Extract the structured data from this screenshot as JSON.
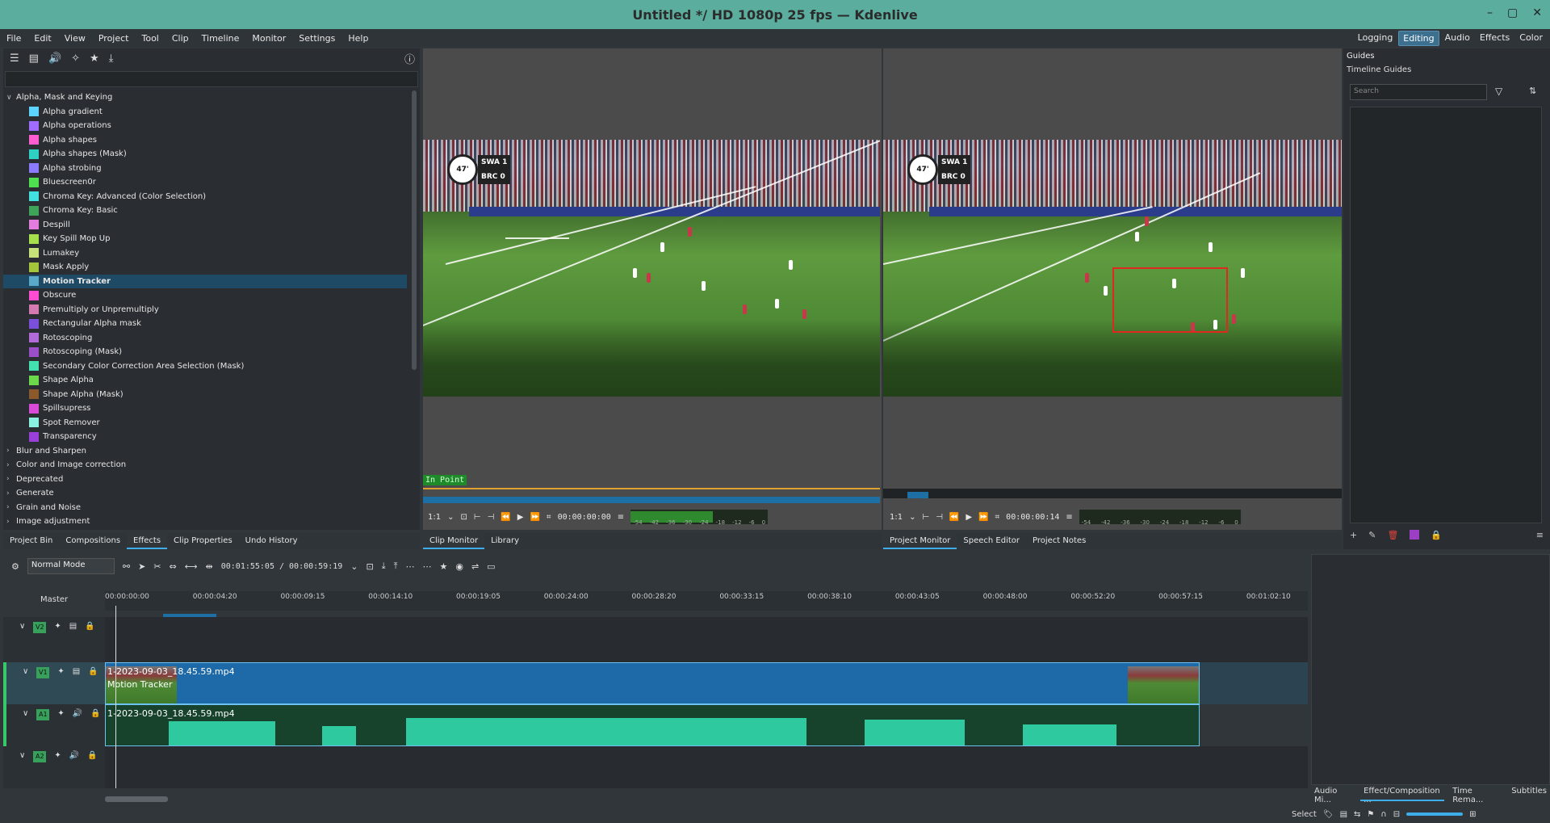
{
  "window": {
    "title": "Untitled */ HD 1080p 25 fps — Kdenlive"
  },
  "menubar": [
    "File",
    "Edit",
    "View",
    "Project",
    "Tool",
    "Clip",
    "Timeline",
    "Monitor",
    "Settings",
    "Help"
  ],
  "layouts": {
    "items": [
      "Logging",
      "Editing",
      "Audio",
      "Effects",
      "Color"
    ],
    "active": "Editing"
  },
  "effects": {
    "tree": [
      {
        "kind": "cat",
        "label": "Alpha, Mask and Keying",
        "open": true
      },
      {
        "kind": "leaf",
        "label": "Alpha gradient",
        "color": "#5dd4ff"
      },
      {
        "kind": "leaf",
        "label": "Alpha operations",
        "color": "#9f6cff"
      },
      {
        "kind": "leaf",
        "label": "Alpha shapes",
        "color": "#ff5ccf"
      },
      {
        "kind": "leaf",
        "label": "Alpha shapes (Mask)",
        "color": "#2ed1c2"
      },
      {
        "kind": "leaf",
        "label": "Alpha strobing",
        "color": "#8a7bff"
      },
      {
        "kind": "leaf",
        "label": "Bluescreen0r",
        "color": "#4fe04f"
      },
      {
        "kind": "leaf",
        "label": "Chroma Key: Advanced (Color Selection)",
        "color": "#43e0e0"
      },
      {
        "kind": "leaf",
        "label": "Chroma Key: Basic",
        "color": "#3fa35a"
      },
      {
        "kind": "leaf",
        "label": "Despill",
        "color": "#e27cdd"
      },
      {
        "kind": "leaf",
        "label": "Key Spill Mop Up",
        "color": "#a6e04a"
      },
      {
        "kind": "leaf",
        "label": "Lumakey",
        "color": "#c6e07a"
      },
      {
        "kind": "leaf",
        "label": "Mask Apply",
        "color": "#a3c63a"
      },
      {
        "kind": "leaf",
        "label": "Motion Tracker",
        "color": "#5aa9c9",
        "selected": true
      },
      {
        "kind": "leaf",
        "label": "Obscure",
        "color": "#ff4cd2"
      },
      {
        "kind": "leaf",
        "label": "Premultiply or Unpremultiply",
        "color": "#d37ab0"
      },
      {
        "kind": "leaf",
        "label": "Rectangular Alpha mask",
        "color": "#7a4fd9"
      },
      {
        "kind": "leaf",
        "label": "Rotoscoping",
        "color": "#b36ad9"
      },
      {
        "kind": "leaf",
        "label": "Rotoscoping (Mask)",
        "color": "#9a4fc9"
      },
      {
        "kind": "leaf",
        "label": "Secondary Color Correction Area Selection (Mask)",
        "color": "#43e0b0"
      },
      {
        "kind": "leaf",
        "label": "Shape Alpha",
        "color": "#6bd94a"
      },
      {
        "kind": "leaf",
        "label": "Shape Alpha (Mask)",
        "color": "#8b5a2a"
      },
      {
        "kind": "leaf",
        "label": "Spillsupress",
        "color": "#d94ad9"
      },
      {
        "kind": "leaf",
        "label": "Spot Remover",
        "color": "#8af0e0"
      },
      {
        "kind": "leaf",
        "label": "Transparency",
        "color": "#9a3fd9"
      },
      {
        "kind": "cat",
        "label": "Blur and Sharpen",
        "open": false
      },
      {
        "kind": "cat",
        "label": "Color and Image correction",
        "open": false
      },
      {
        "kind": "cat",
        "label": "Deprecated",
        "open": false
      },
      {
        "kind": "cat",
        "label": "Generate",
        "open": false
      },
      {
        "kind": "cat",
        "label": "Grain and Noise",
        "open": false
      },
      {
        "kind": "cat",
        "label": "Image adjustment",
        "open": false
      }
    ]
  },
  "left_tabs": [
    "Project Bin",
    "Compositions",
    "Effects",
    "Clip Properties",
    "Undo History"
  ],
  "left_tabs_active": "Effects",
  "clip_monitor": {
    "badge": "In Point",
    "zoom": "1:1",
    "timecode": "00:00:00:00",
    "tabs": [
      "Clip Monitor",
      "Library"
    ],
    "active_tab": "Clip Monitor"
  },
  "project_monitor": {
    "zoom": "1:1",
    "timecode": "00:00:00:14",
    "tabs": [
      "Project Monitor",
      "Speech Editor",
      "Project Notes"
    ],
    "active_tab": "Project Monitor"
  },
  "scorebug": {
    "minute": "47'",
    "team1": "SWA",
    "team2": "BRC",
    "score1": "1",
    "score2": "0"
  },
  "vu_scale": [
    "-54",
    "-42",
    "-36",
    "-30",
    "-24",
    "-18",
    "-12",
    "-6",
    "0"
  ],
  "guides": {
    "title": "Guides",
    "subtitle": "Timeline Guides",
    "search_placeholder": "Search"
  },
  "timeline": {
    "mode": "Normal Mode",
    "position": "00:01:55:05 / 00:00:59:19",
    "master_label": "Master",
    "ticks": [
      "00:00:00:00",
      "00:00:04:20",
      "00:00:09:15",
      "00:00:14:10",
      "00:00:19:05",
      "00:00:24:00",
      "00:00:28:20",
      "00:00:33:15",
      "00:00:38:10",
      "00:00:43:05",
      "00:00:48:00",
      "00:00:52:20",
      "00:00:57:15",
      "00:01:02:10"
    ],
    "tracks": [
      "V2",
      "V1",
      "A1",
      "A2"
    ],
    "video_clip": {
      "name": "1-2023-09-03_18.45.59.mp4",
      "effect": "Motion Tracker"
    },
    "audio_clip": {
      "name": "1-2023-09-03_18.45.59.mp4"
    }
  },
  "bottom_tabs": [
    "Audio Mi...",
    "Effect/Composition ...",
    "Time Rema...",
    "Subtitles"
  ],
  "bottom_tabs_active": "Effect/Composition ...",
  "status": {
    "tool": "Select"
  }
}
